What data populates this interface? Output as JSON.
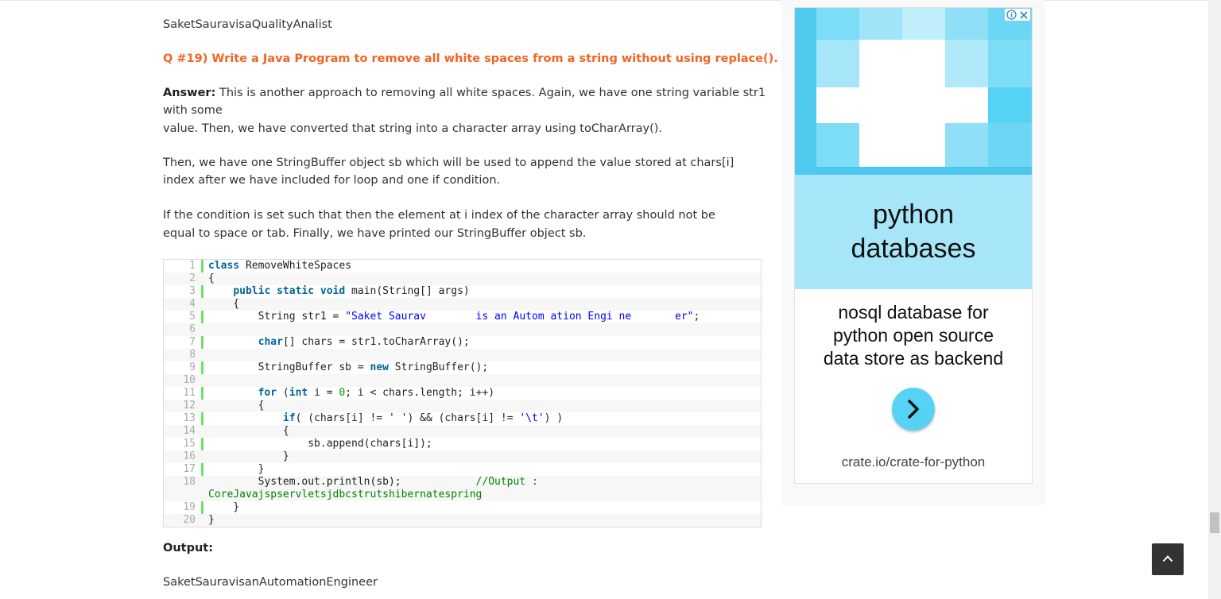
{
  "article": {
    "prev_output": "SaketSauravisaQualityAnalist",
    "question": "Q #19) Write a Java Program to remove all white spaces from a string without using replace().",
    "answer_label": "Answer:",
    "answer_line1": " This is another approach to removing all white spaces. Again, we have one string variable str1",
    "answer_line2": "with some",
    "answer_line3": "value. Then, we have converted that string into a character array using toCharArray().",
    "para2_line1": "Then, we have one StringBuffer object sb which will be used to append the value stored at chars[i]",
    "para2_line2": "index after we have included for loop and one if condition.",
    "para3_line1": "If the condition is set such that then the element at i index of the character array should not be",
    "para3_line2": "equal to space or tab. Finally, we have printed our StringBuffer object sb.",
    "output_label": "Output:",
    "output_value": "SaketSauravisanAutomationEngineer"
  },
  "code": {
    "line_numbers": [
      "1",
      "2",
      "3",
      "4",
      "5",
      "6",
      "7",
      "8",
      "9",
      "10",
      "11",
      "12",
      "13",
      "14",
      "15",
      "16",
      "17",
      "18",
      "",
      "19",
      "20"
    ],
    "t": {
      "l1_kw": "class",
      "l1_rest": " RemoveWhiteSpaces",
      "l2": "{",
      "l3_ind": "    ",
      "l3_kw": "public static void",
      "l3_rest": " main(String[] args)",
      "l4": "    {",
      "l5_pre": "        String str1 = ",
      "l5_str": "\"Saket Saurav        is an Autom ation Engi ne       er\"",
      "l5_end": ";",
      "l7_ind": "        ",
      "l7_kw": "char",
      "l7_rest": "[] chars = str1.toCharArray();",
      "l9_pre": "        StringBuffer sb = ",
      "l9_kw": "new",
      "l9_rest": " StringBuffer();",
      "l11_ind": "        ",
      "l11_kw1": "for",
      "l11_a": " (",
      "l11_kw2": "int",
      "l11_b": " i = ",
      "l11_num": "0",
      "l11_c": "; i < chars.length; i++)",
      "l12": "        {",
      "l13_ind": "            ",
      "l13_kw": "if",
      "l13_a": "( (chars[i] != ",
      "l13_s1": "' '",
      "l13_b": ") && (chars[i] != ",
      "l13_s2": "'\\t'",
      "l13_c": ") )",
      "l14": "            {",
      "l15": "                sb.append(chars[i]);",
      "l16": "            }",
      "l17": "        }",
      "l18_pre": "        System.out.println(sb);            ",
      "l18_cm": "//Output :",
      "l18b_cm": "CoreJavajspservletsjdbcstrutshibernatespring",
      "l19": "    }",
      "l20": "}"
    }
  },
  "ad": {
    "headline_1": "python",
    "headline_2": "databases",
    "desc_1": "nosql database for",
    "desc_2": "python open source",
    "desc_3": "data store as backend",
    "url": "crate.io/crate-for-python",
    "info_icon": "info-icon",
    "close_icon": "close-icon",
    "colors": {
      "accent": "#55d2f4",
      "band": "#a7e6f8"
    }
  },
  "ui": {
    "back_to_top_icon": "chevron-up-icon"
  }
}
